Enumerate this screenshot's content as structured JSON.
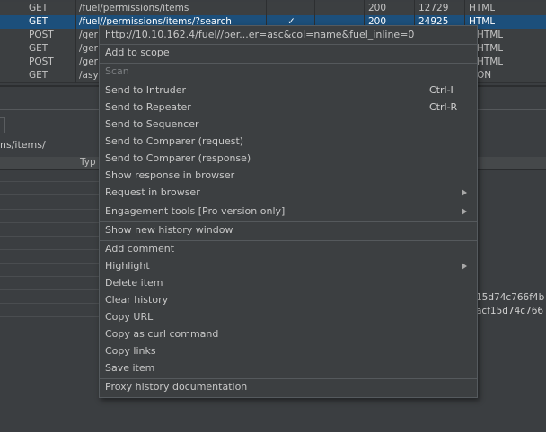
{
  "history": {
    "rows": [
      {
        "method": "GET",
        "url": "/fuel/permissions/items",
        "edited": "",
        "status": "200",
        "length": "12729",
        "mime": "HTML"
      },
      {
        "method": "GET",
        "url": "/fuel//permissions/items/?search",
        "edited": "✓",
        "status": "200",
        "length": "24925",
        "mime": "HTML",
        "selected": true
      },
      {
        "method": "POST",
        "url": "/ger",
        "edited": "",
        "status": "",
        "length": "",
        "mime": "HTML"
      },
      {
        "method": "GET",
        "url": "/ger",
        "edited": "",
        "status": "",
        "length": "",
        "mime": "HTML"
      },
      {
        "method": "POST",
        "url": "/ger",
        "edited": "",
        "status": "",
        "length": "",
        "mime": "HTML"
      },
      {
        "method": "GET",
        "url": "/asy",
        "edited": "",
        "status": "",
        "length": "",
        "mime": "ON"
      }
    ]
  },
  "lower": {
    "path": "ns/items/",
    "column_header": "Typ",
    "hash_1": "15d74c766f4b",
    "hash_2": "acf15d74c766"
  },
  "context_menu": {
    "title_url": "http://10.10.162.4/fuel//per...er=asc&col=name&fuel_inline=0",
    "items": [
      {
        "label": "Add to scope"
      },
      {
        "label": "Scan",
        "disabled": true
      },
      {
        "label": "Send to Intruder",
        "shortcut": "Ctrl-I"
      },
      {
        "label": "Send to Repeater",
        "shortcut": "Ctrl-R"
      },
      {
        "label": "Send to Sequencer"
      },
      {
        "label": "Send to Comparer (request)"
      },
      {
        "label": "Send to Comparer (response)"
      },
      {
        "label": "Show response in browser"
      },
      {
        "label": "Request in browser",
        "submenu": true
      },
      {
        "label": "Engagement tools [Pro version only]",
        "submenu": true
      },
      {
        "label": "Show new history window"
      },
      {
        "label": "Add comment"
      },
      {
        "label": "Highlight",
        "submenu": true
      },
      {
        "label": "Delete item"
      },
      {
        "label": "Clear history"
      },
      {
        "label": "Copy URL"
      },
      {
        "label": "Copy as curl command"
      },
      {
        "label": "Copy links"
      },
      {
        "label": "Save item"
      },
      {
        "label": "Proxy history documentation"
      }
    ]
  }
}
